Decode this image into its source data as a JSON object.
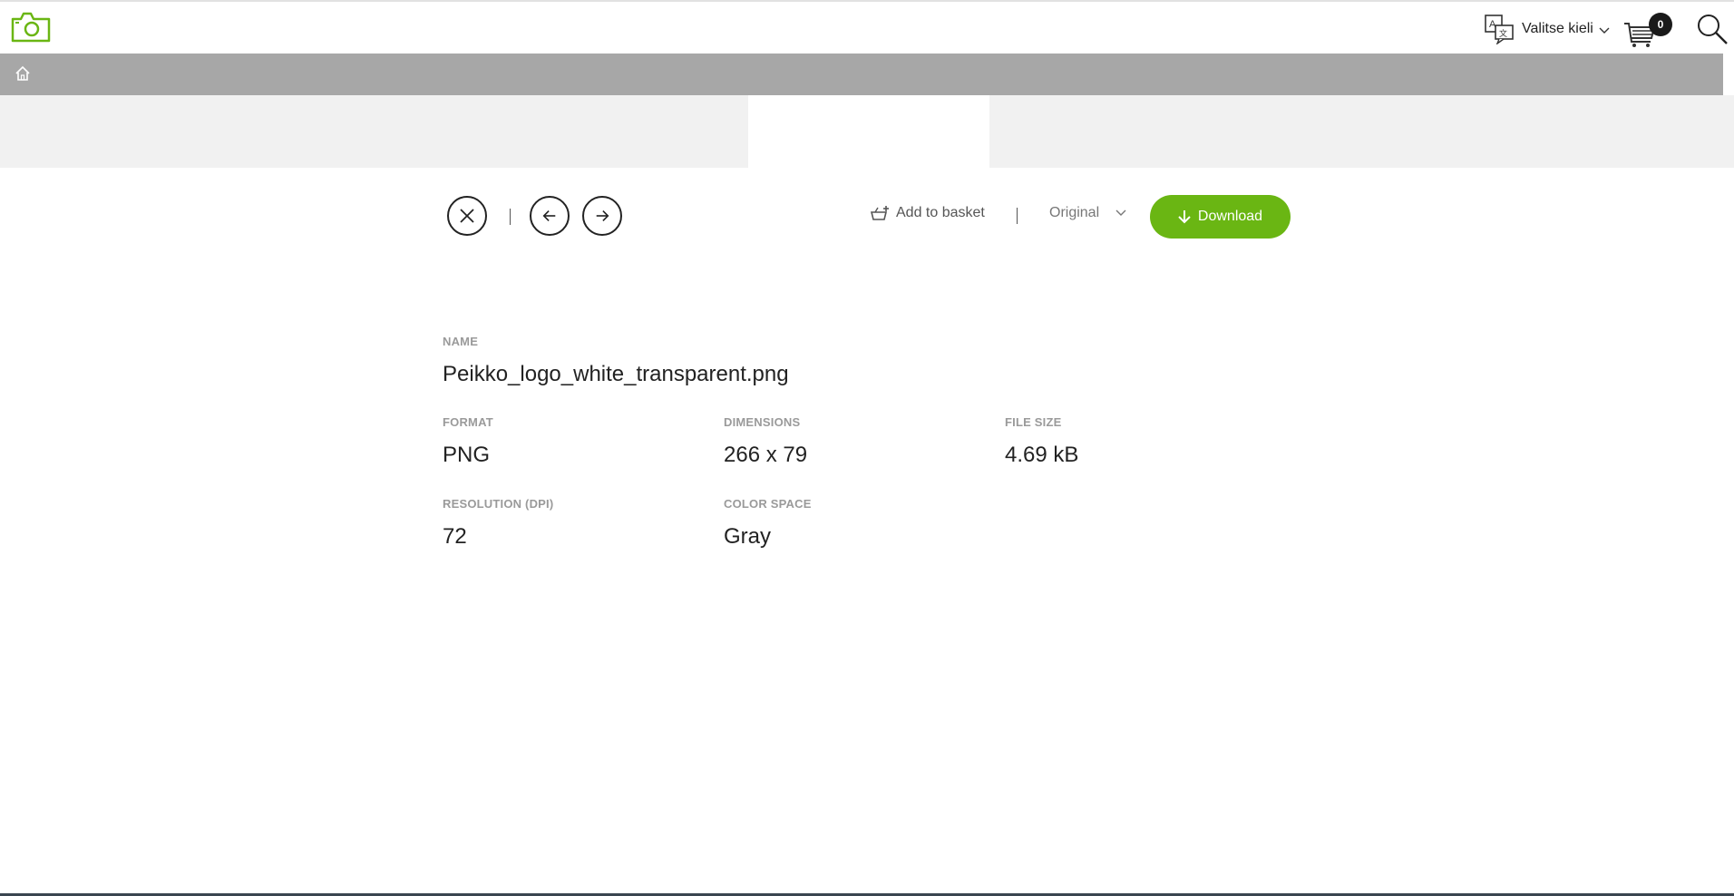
{
  "header": {
    "logo_icon": "camera-icon",
    "brand_color": "#6ab613",
    "language_label": "Valitse kieli",
    "basket_count": "0"
  },
  "toolbar": {
    "add_to_basket_label": "Add to basket",
    "size_selected": "Original",
    "download_label": "Download"
  },
  "metadata": {
    "name_label": "NAME",
    "name_value": "Peikko_logo_white_transparent.png",
    "format_label": "FORMAT",
    "format_value": "PNG",
    "dimensions_label": "DIMENSIONS",
    "dimensions_value": "266 x 79",
    "filesize_label": "FILE SIZE",
    "filesize_value": "4.69 kB",
    "resolution_label": "RESOLUTION (DPI)",
    "resolution_value": "72",
    "colorspace_label": "COLOR SPACE",
    "colorspace_value": "Gray"
  }
}
